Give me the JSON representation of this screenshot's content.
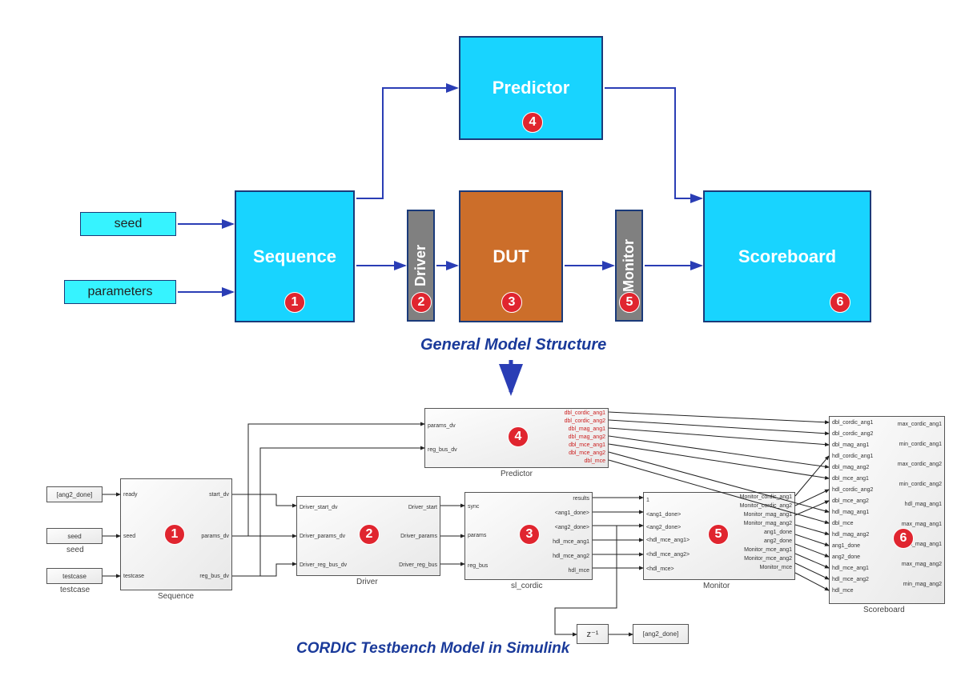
{
  "top": {
    "seed": "seed",
    "parameters": "parameters",
    "sequence": "Sequence",
    "driver": "Driver",
    "dut": "DUT",
    "predictor": "Predictor",
    "monitor": "Monitor",
    "scoreboard": "Scoreboard",
    "caption": "General  Model Structure"
  },
  "badges": {
    "b1": "1",
    "b2": "2",
    "b3": "3",
    "b4": "4",
    "b5": "5",
    "b6": "6"
  },
  "bottom": {
    "caption": "CORDIC Testbench Model in Simulink",
    "delay": "z⁻¹",
    "blocks": {
      "sequence": "Sequence",
      "driver": "Driver",
      "sl_cordic": "sl_cordic",
      "predictor": "Predictor",
      "monitor": "Monitor",
      "scoreboard": "Scoreboard"
    },
    "inputs": {
      "ang2_done_tag": "[ang2_done]",
      "seed_tag": "seed",
      "seed_label": "seed",
      "testcase_tag": "testcase",
      "testcase_label": "testcase",
      "ang2_done_out": "[ang2_done]"
    },
    "seq_ports": {
      "in": [
        "ready",
        "seed",
        "testcase"
      ],
      "out": [
        "start_dv",
        "params_dv",
        "reg_bus_dv"
      ]
    },
    "drv_ports": {
      "in": [
        "Driver_start_dv",
        "Driver_params_dv",
        "Driver_reg_bus_dv"
      ],
      "out": [
        "Driver_start",
        "Driver_params",
        "Driver_reg_bus"
      ]
    },
    "dut_ports": {
      "in": [
        "sync",
        "params",
        "reg_bus"
      ],
      "out": [
        "results",
        "<ang1_done>",
        "<ang2_done>",
        "hdl_mce_ang1",
        "hdl_mce_ang2",
        "hdl_mce"
      ]
    },
    "pred_ports": {
      "in": [
        "params_dv",
        "reg_bus_dv"
      ],
      "out": [
        "dbl_cordic_ang1",
        "dbl_cordic_ang2",
        "dbl_mag_ang1",
        "dbl_mag_ang2",
        "dbl_mce_ang1",
        "dbl_mce_ang2",
        "dbl_mce"
      ]
    },
    "mon_ports": {
      "in": [
        "1",
        "<ang1_done>",
        "<ang2_done>",
        "<hdl_mce_ang1>",
        "<hdl_mce_ang2>",
        "<hdl_mce>"
      ],
      "out": [
        "Monitor_cordic_ang1",
        "Monitor_cordic_ang2",
        "Monitor_mag_ang1",
        "Monitor_mag_ang2",
        "ang1_done",
        "ang2_done",
        "Monitor_mce_ang1",
        "Monitor_mce_ang2",
        "Monitor_mce"
      ]
    },
    "sb_ports": {
      "in": [
        "dbl_cordic_ang1",
        "dbl_cordic_ang2",
        "dbl_mag_ang1",
        "hdl_cordic_ang1",
        "dbl_mag_ang2",
        "dbl_mce_ang1",
        "hdl_cordic_ang2",
        "dbl_mce_ang2",
        "hdl_mag_ang1",
        "dbl_mce",
        "hdl_mag_ang2",
        "ang1_done",
        "ang2_done",
        "hdl_mce_ang1",
        "hdl_mce_ang2",
        "hdl_mce"
      ],
      "out": [
        "max_cordic_ang1",
        "min_cordic_ang1",
        "max_cordic_ang2",
        "min_cordic_ang2",
        "hdl_mag_ang1",
        "max_mag_ang1",
        "min_mag_ang1",
        "max_mag_ang2",
        "min_mag_ang2"
      ]
    }
  }
}
